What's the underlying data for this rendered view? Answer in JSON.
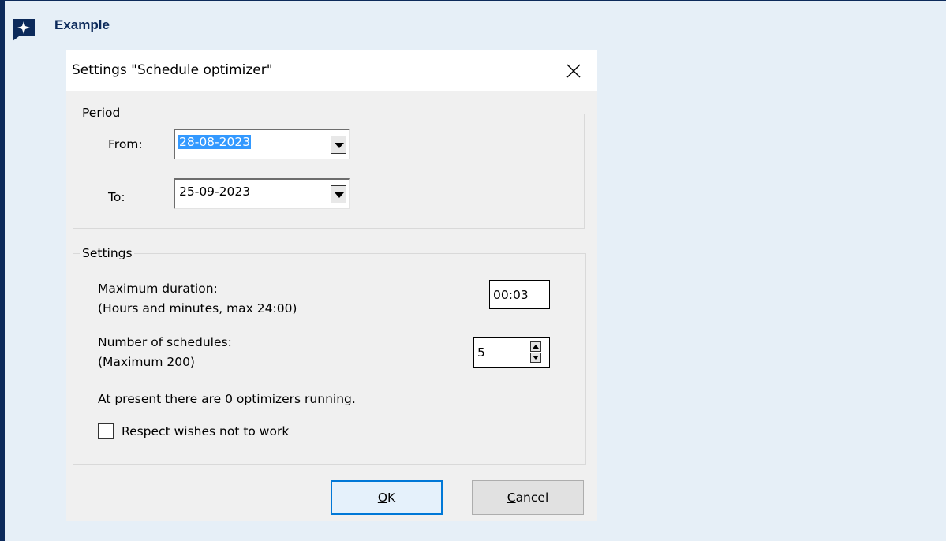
{
  "callout": {
    "title": "Example",
    "icon": "sparkle-icon",
    "accent_color": "#0c2a5b"
  },
  "dialog": {
    "title": "Settings \"Schedule optimizer\"",
    "close_icon": "close-icon",
    "period": {
      "legend": "Period",
      "from_label": "From:",
      "from_value": "28-08-2023",
      "to_label": "To:",
      "to_value": "25-09-2023"
    },
    "settings": {
      "legend": "Settings",
      "max_duration_label": "Maximum duration:",
      "max_duration_hint": "(Hours and minutes, max 24:00)",
      "max_duration_value": "00:03",
      "num_schedules_label": "Number of schedules:",
      "num_schedules_hint": "(Maximum 200)",
      "num_schedules_value": "5",
      "status_text": "At present there are 0 optimizers running.",
      "respect_wishes_label": "Respect wishes not to work",
      "respect_wishes_checked": false
    },
    "buttons": {
      "ok_mnemonic": "O",
      "ok_rest": "K",
      "cancel_mnemonic": "C",
      "cancel_rest": "ancel"
    }
  }
}
